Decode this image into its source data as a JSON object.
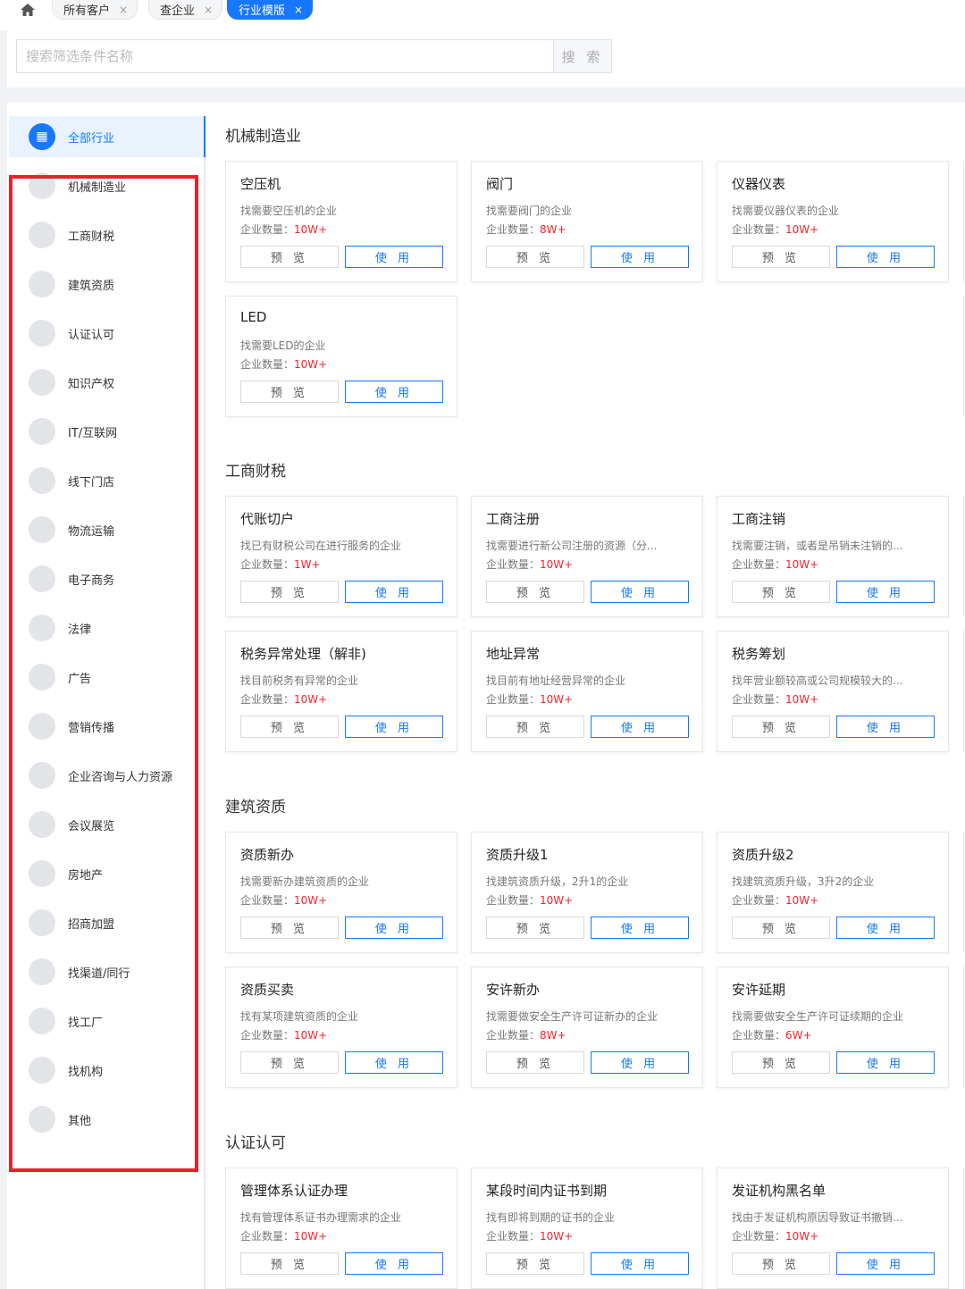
{
  "tabs": [
    {
      "label": "所有客户",
      "active": false
    },
    {
      "label": "查企业",
      "active": false
    },
    {
      "label": "行业模版",
      "active": true
    }
  ],
  "search": {
    "placeholder": "搜索筛选条件名称",
    "button": "搜 索"
  },
  "sidebar": {
    "items": [
      {
        "label": "全部行业",
        "icon": "grid-icon",
        "active": true
      },
      {
        "label": "机械制造业",
        "icon": "wrench-icon"
      },
      {
        "label": "工商财税",
        "icon": "yen-icon"
      },
      {
        "label": "建筑资质",
        "icon": "certificate-icon"
      },
      {
        "label": "认证认可",
        "icon": "badge-icon"
      },
      {
        "label": "知识产权",
        "icon": "ip-icon"
      },
      {
        "label": "IT/互联网",
        "icon": "globe-icon"
      },
      {
        "label": "线下门店",
        "icon": "store-icon"
      },
      {
        "label": "物流运输",
        "icon": "truck-icon"
      },
      {
        "label": "电子商务",
        "icon": "cart-icon"
      },
      {
        "label": "法律",
        "icon": "scale-icon"
      },
      {
        "label": "广告",
        "icon": "megaphone-icon"
      },
      {
        "label": "营销传播",
        "icon": "broadcast-icon"
      },
      {
        "label": "企业咨询与人力资源",
        "icon": "consult-icon"
      },
      {
        "label": "会议展览",
        "icon": "exhibition-icon"
      },
      {
        "label": "房地产",
        "icon": "house-icon"
      },
      {
        "label": "招商加盟",
        "icon": "handshake-icon"
      },
      {
        "label": "找渠道/同行",
        "icon": "user-icon"
      },
      {
        "label": "找工厂",
        "icon": "factory-icon"
      },
      {
        "label": "找机构",
        "icon": "institution-icon"
      },
      {
        "label": "其他",
        "icon": "more-icon"
      }
    ]
  },
  "labels": {
    "count_prefix": "企业数量：",
    "preview": "预 览",
    "use": "使 用"
  },
  "sections": [
    {
      "title": "机械制造业",
      "cards": [
        {
          "title": "空压机",
          "desc": "找需要空压机的企业",
          "count": "10W+"
        },
        {
          "title": "阀门",
          "desc": "找需要阀门的企业",
          "count": "8W+"
        },
        {
          "title": "仪器仪表",
          "desc": "找需要仪器仪表的企业",
          "count": "10W+"
        },
        {
          "title": "LED",
          "desc": "找需要LED的企业",
          "count": "10W+"
        }
      ]
    },
    {
      "title": "工商财税",
      "cards": [
        {
          "title": "代账切户",
          "desc": "找已有财税公司在进行服务的企业",
          "count": "1W+"
        },
        {
          "title": "工商注册",
          "desc": "找需要进行新公司注册的资源（分...",
          "count": "10W+"
        },
        {
          "title": "工商注销",
          "desc": "找需要注销，或者是吊销未注销的...",
          "count": "10W+"
        },
        {
          "title": "税务异常处理（解非)",
          "desc": "找目前税务有异常的企业",
          "count": "10W+"
        },
        {
          "title": "地址异常",
          "desc": "找目前有地址经营异常的企业",
          "count": "10W+"
        },
        {
          "title": "税务筹划",
          "desc": "找年营业额较高或公司规模较大的...",
          "count": "10W+"
        }
      ]
    },
    {
      "title": "建筑资质",
      "cards": [
        {
          "title": "资质新办",
          "desc": "找需要新办建筑资质的企业",
          "count": "10W+"
        },
        {
          "title": "资质升级1",
          "desc": "找建筑资质升级，2升1的企业",
          "count": "10W+"
        },
        {
          "title": "资质升级2",
          "desc": "找建筑资质升级，3升2的企业",
          "count": "10W+"
        },
        {
          "title": "资质买卖",
          "desc": "找有某项建筑资质的企业",
          "count": "10W+"
        },
        {
          "title": "安许新办",
          "desc": "找需要做安全生产许可证新办的企业",
          "count": "8W+"
        },
        {
          "title": "安许延期",
          "desc": "找需要做安全生产许可证续期的企业",
          "count": "6W+"
        }
      ]
    },
    {
      "title": "认证认可",
      "cards": [
        {
          "title": "管理体系认证办理",
          "desc": "找有管理体系证书办理需求的企业",
          "count": "10W+"
        },
        {
          "title": "某段时间内证书到期",
          "desc": "找有即将到期的证书的企业",
          "count": "10W+"
        },
        {
          "title": "发证机构黑名单",
          "desc": "找由于发证机构原因导致证书撤销...",
          "count": "10W+"
        }
      ]
    }
  ]
}
